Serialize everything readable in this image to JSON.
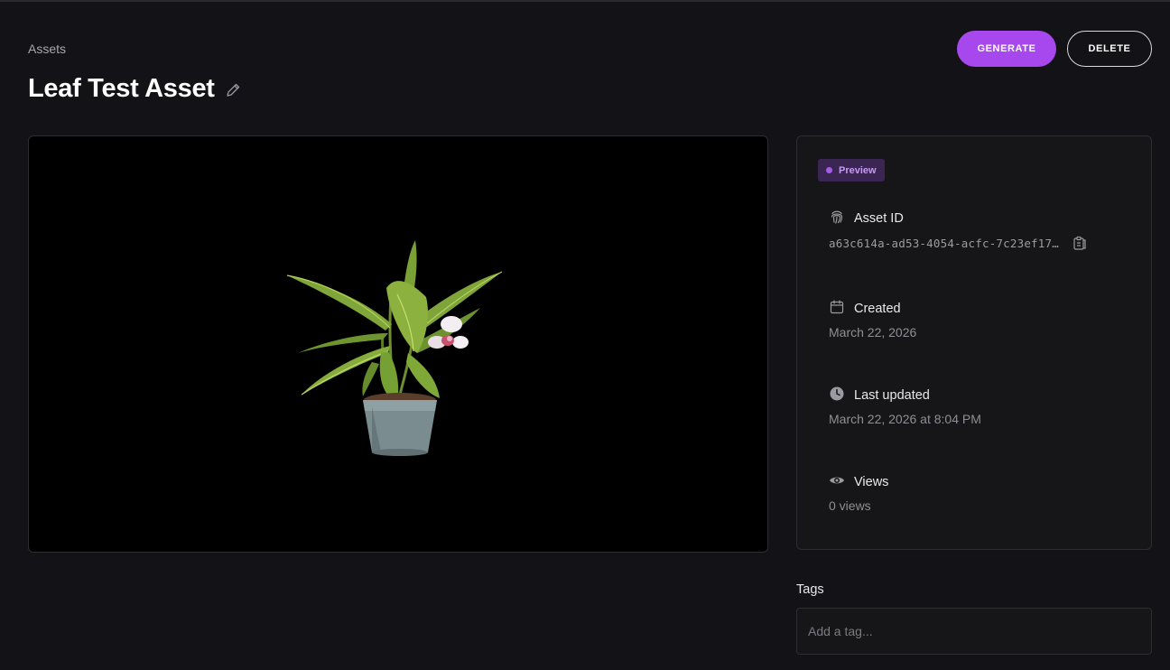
{
  "breadcrumb": {
    "label": "Assets"
  },
  "header": {
    "title": "Leaf Test Asset",
    "generate_label": "GENERATE",
    "delete_label": "DELETE"
  },
  "viewer": {
    "content": "potted-plant-3d-preview",
    "background": "#000000"
  },
  "info": {
    "badge": "Preview",
    "asset_id": {
      "label": "Asset ID",
      "value": "a63c614a-ad53-4054-acfc-7c23ef17…",
      "icon": "fingerprint-icon"
    },
    "created": {
      "label": "Created",
      "value": "March 22, 2026",
      "icon": "calendar-icon"
    },
    "updated": {
      "label": "Last updated",
      "value": "March 22, 2026 at 8:04 PM",
      "icon": "clock-icon"
    },
    "views": {
      "label": "Views",
      "value": "0 views",
      "icon": "eye-icon"
    }
  },
  "tags": {
    "label": "Tags",
    "placeholder": "Add a tag..."
  },
  "colors": {
    "accent": "#a748ef",
    "background": "#131317",
    "card": "#161618",
    "badge_bg": "#3a2553"
  }
}
